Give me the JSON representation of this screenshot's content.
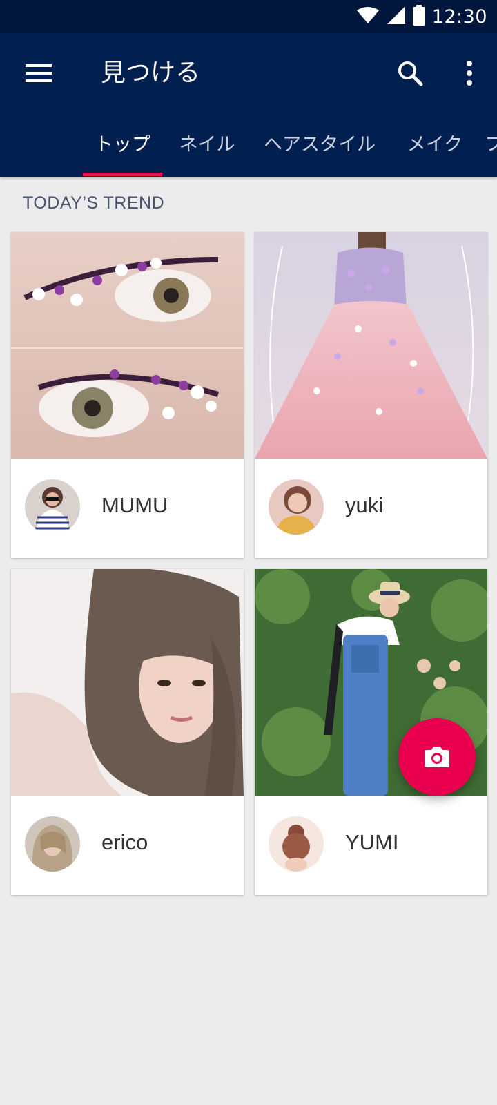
{
  "status_bar": {
    "time": "12:30",
    "icons": [
      "wifi-icon",
      "signal-icon",
      "battery-icon"
    ]
  },
  "app_bar": {
    "title": "見つける",
    "menu_icon": "menu-icon",
    "search_icon": "search-icon",
    "more_icon": "more-vert-icon",
    "background": "#02204f"
  },
  "tabs": [
    {
      "label": "トップ",
      "active": true
    },
    {
      "label": "ネイル",
      "active": false
    },
    {
      "label": "ヘアスタイル",
      "active": false
    },
    {
      "label": "メイク",
      "active": false
    },
    {
      "label": "フ",
      "active": false
    }
  ],
  "section": {
    "title": "TODAY’S TREND"
  },
  "cards": [
    {
      "username": "MUMU",
      "photo": "eye makeup with flowers"
    },
    {
      "username": "yuki",
      "photo": "pink flower gown"
    },
    {
      "username": "erico",
      "photo": "portrait with wavy hair"
    },
    {
      "username": "YUMI",
      "photo": "denim overalls outfit"
    }
  ],
  "fab": {
    "icon": "camera-icon",
    "color": "#e8004f"
  },
  "accent_color": "#e6104f"
}
